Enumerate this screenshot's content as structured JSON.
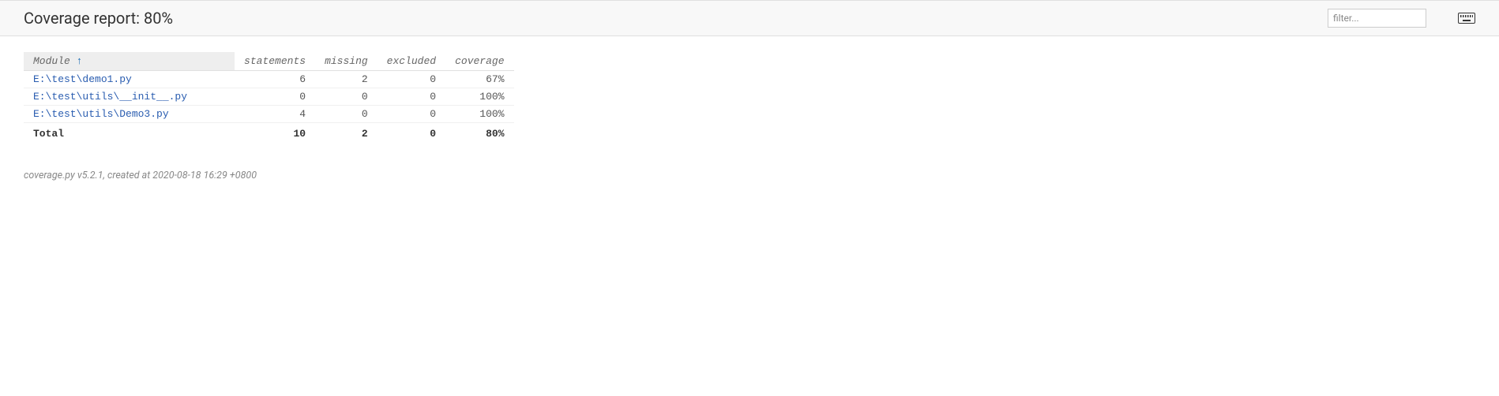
{
  "header": {
    "title": "Coverage report: 80%",
    "filter_placeholder": "filter..."
  },
  "table": {
    "headers": {
      "module": "Module",
      "sort_indicator": "↑",
      "statements": "statements",
      "missing": "missing",
      "excluded": "excluded",
      "coverage": "coverage"
    },
    "rows": [
      {
        "module": "E:\\test\\demo1.py",
        "statements": "6",
        "missing": "2",
        "excluded": "0",
        "coverage": "67%"
      },
      {
        "module": "E:\\test\\utils\\__init__.py",
        "statements": "0",
        "missing": "0",
        "excluded": "0",
        "coverage": "100%"
      },
      {
        "module": "E:\\test\\utils\\Demo3.py",
        "statements": "4",
        "missing": "0",
        "excluded": "0",
        "coverage": "100%"
      }
    ],
    "total": {
      "label": "Total",
      "statements": "10",
      "missing": "2",
      "excluded": "0",
      "coverage": "80%"
    }
  },
  "footer": {
    "text": "coverage.py v5.2.1, created at 2020-08-18 16:29 +0800"
  }
}
